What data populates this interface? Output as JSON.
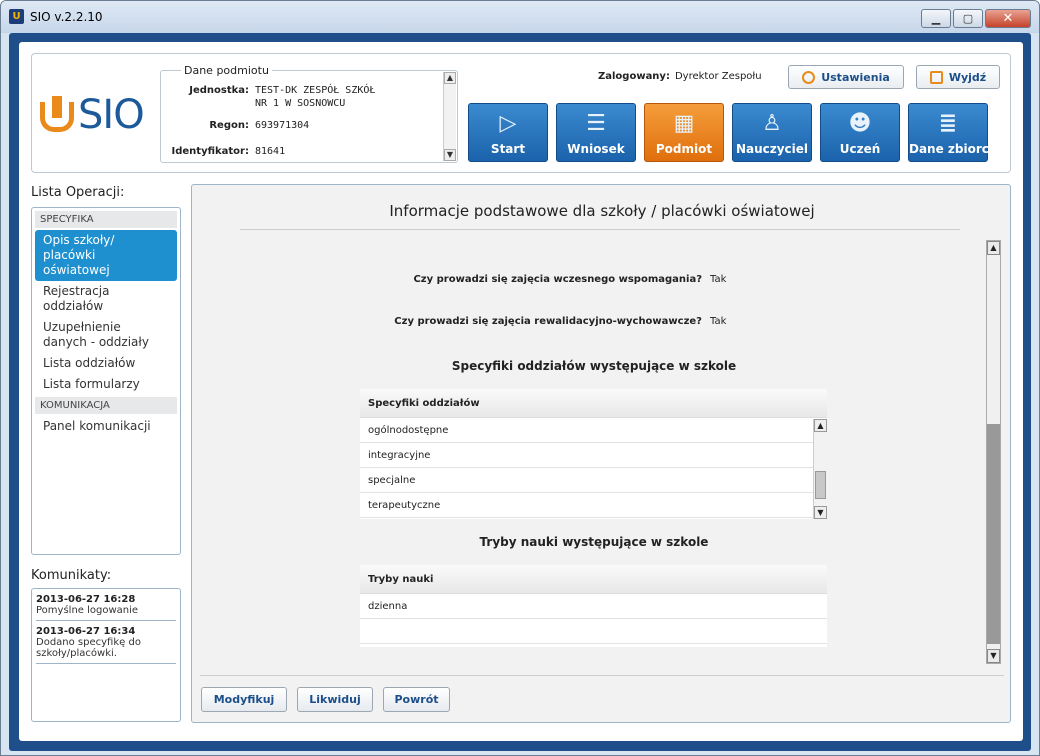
{
  "window": {
    "title": "SIO v.2.2.10",
    "app_icon": "shield-icon"
  },
  "logo": {
    "text": "SIO",
    "color": "#1c5a9a",
    "accent": "#e98a1b"
  },
  "dane_podmiotu": {
    "legend": "Dane podmiotu",
    "rows": [
      {
        "label": "Jednostka:",
        "value_line1": "TEST-DK ZESPÓŁ SZKÓŁ",
        "value_line2": "NR 1 W SOSNOWCU"
      },
      {
        "label": "Regon:",
        "value": "693971304"
      },
      {
        "label": "Identyfikator:",
        "value": "81641"
      }
    ]
  },
  "user": {
    "label": "Zalogowany:",
    "name": "Dyrektor Zespołu"
  },
  "header_buttons": {
    "settings": "Ustawienia",
    "logout": "Wyjdź"
  },
  "tiles": [
    {
      "label": "Start",
      "icon": "play-icon",
      "active": false
    },
    {
      "label": "Wniosek",
      "icon": "database-icon",
      "active": false
    },
    {
      "label": "Podmiot",
      "icon": "building-icon",
      "active": true
    },
    {
      "label": "Nauczyciel",
      "icon": "teacher-icon",
      "active": false
    },
    {
      "label": "Uczeń",
      "icon": "student-icon",
      "active": false
    },
    {
      "label": "Dane zbiorcze",
      "icon": "stack-icon",
      "active": false
    }
  ],
  "operations": {
    "title": "Lista Operacji:",
    "sections": [
      {
        "name": "SPECYFIKA",
        "items": [
          {
            "label_l1": "Opis szkoły/",
            "label_l2": "placówki",
            "label_l3": "oświatowej"
          },
          {
            "label_l1": "Rejestracja",
            "label_l2": "oddziałów"
          },
          {
            "label_l1": "Uzupełnienie",
            "label_l2": "danych - oddziały"
          },
          {
            "label_l1": "Lista oddziałów"
          },
          {
            "label_l1": "Lista formularzy"
          }
        ]
      },
      {
        "name": "KOMUNIKACJA",
        "items": [
          {
            "label_l1": "Panel komunikacji"
          }
        ]
      }
    ]
  },
  "messages": {
    "title": "Komunikaty:",
    "items": [
      {
        "date": "2013-06-27 16:28",
        "text_l1": "Pomyślne logowanie"
      },
      {
        "date": "2013-06-27 16:34",
        "text_l1": "Dodano specyfikę do",
        "text_l2": "szkoły/placówki."
      }
    ]
  },
  "main": {
    "title": "Informacje podstawowe dla szkoły / placówki oświatowej",
    "questions": [
      {
        "label": "Czy prowadzi się zajęcia wczesnego wspomagania?",
        "value": "Tak"
      },
      {
        "label": "Czy prowadzi się zajęcia rewalidacyjno-wychowawcze?",
        "value": "Tak"
      }
    ],
    "specyfiki": {
      "title": "Specyfiki oddziałów występujące w szkole",
      "header": "Specyfiki oddziałów",
      "rows": [
        "ogólnodostępne",
        "integracyjne",
        "specjalne",
        "terapeutyczne"
      ]
    },
    "tryby": {
      "title": "Tryby nauki występujące w szkole",
      "header": "Tryby nauki",
      "rows": [
        "dzienna",
        ""
      ]
    },
    "actions": {
      "modify": "Modyfikuj",
      "liquidate": "Likwiduj",
      "back": "Powrót"
    }
  }
}
